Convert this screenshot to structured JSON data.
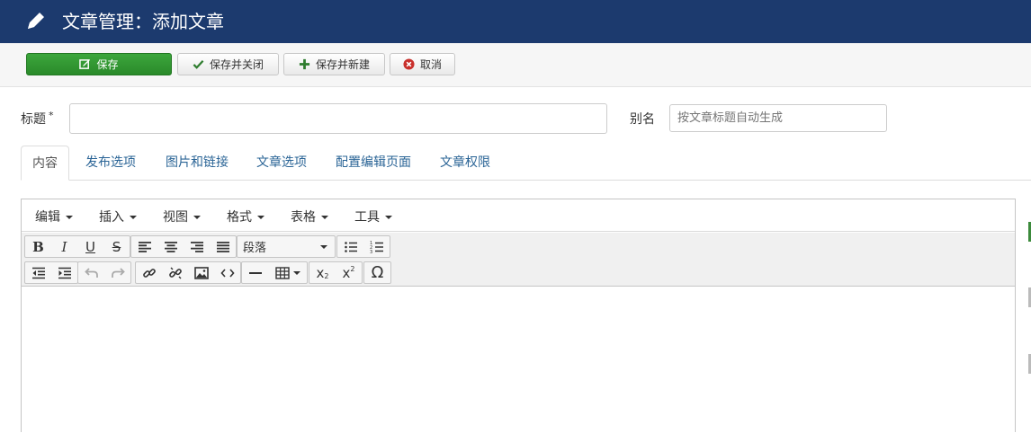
{
  "header": {
    "title": "文章管理：添加文章",
    "icon": "pencil-icon",
    "bg": "#1c3a6e"
  },
  "toolbar": {
    "save": "保存",
    "save_close": "保存并关闭",
    "save_new": "保存并新建",
    "cancel": "取消"
  },
  "form": {
    "title_label": "标题",
    "required_mark": "*",
    "title_value": "",
    "alias_label": "别名",
    "alias_placeholder": "按文章标题自动生成"
  },
  "tabs": [
    {
      "label": "内容",
      "active": true
    },
    {
      "label": "发布选项"
    },
    {
      "label": "图片和链接"
    },
    {
      "label": "文章选项"
    },
    {
      "label": "配置编辑页面"
    },
    {
      "label": "文章权限"
    }
  ],
  "editor": {
    "menus": [
      "编辑",
      "插入",
      "视图",
      "格式",
      "表格",
      "工具"
    ],
    "format_select": "段落"
  }
}
